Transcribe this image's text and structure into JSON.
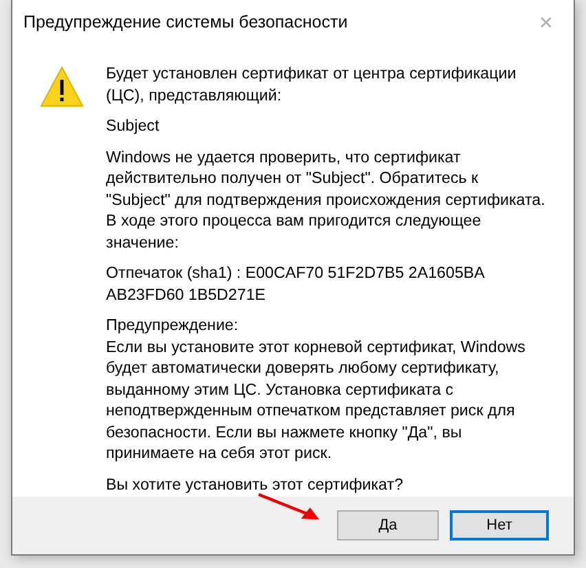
{
  "window": {
    "title": "Предупреждение системы безопасности",
    "close": "✕"
  },
  "message": {
    "paragraphs": [
      "Будет установлен сертификат от центра сертификации (ЦС), представляющий:",
      "Subject",
      "Windows не удается проверить, что сертификат действительно получен от \"Subject\". Обратитесь к \"Subject\" для подтверждения происхождения сертификата. В ходе этого процесса вам пригодится следующее значение:",
      "Отпечаток (sha1) : E00CAF70 51F2D7B5 2A1605BA AB23FD60 1B5D271E",
      "Предупреждение:\nЕсли вы установите этот корневой сертификат, Windows будет автоматически доверять любому сертификату, выданному этим ЦС. Установка сертификата с неподтвержденным отпечатком представляет риск для безопасности. Если вы нажмете кнопку \"Да\", вы принимаете на себя этот риск.",
      "Вы хотите установить этот сертификат?"
    ]
  },
  "buttons": [
    {
      "label": "Да",
      "focused": false
    },
    {
      "label": "Нет",
      "focused": true
    }
  ]
}
